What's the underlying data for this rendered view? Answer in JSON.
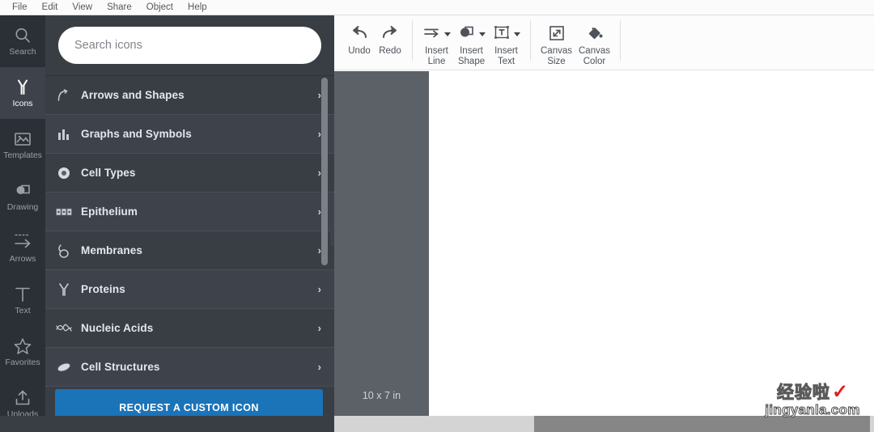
{
  "menubar": {
    "items": [
      {
        "label": "File",
        "name": "menu-file"
      },
      {
        "label": "Edit",
        "name": "menu-edit"
      },
      {
        "label": "View",
        "name": "menu-view"
      },
      {
        "label": "Share",
        "name": "menu-share"
      },
      {
        "label": "Object",
        "name": "menu-object"
      },
      {
        "label": "Help",
        "name": "menu-help"
      }
    ]
  },
  "rail": {
    "items": [
      {
        "label": "Search",
        "icon": "search-icon",
        "active": false
      },
      {
        "label": "Icons",
        "icon": "antibody-icon",
        "active": true
      },
      {
        "label": "Templates",
        "icon": "image-frame-icon",
        "active": false
      },
      {
        "label": "Drawing",
        "icon": "shapes-icon",
        "active": false
      },
      {
        "label": "Arrows",
        "icon": "arrow-right-icon",
        "active": false
      },
      {
        "label": "Text",
        "icon": "text-t-icon",
        "active": false
      },
      {
        "label": "Favorites",
        "icon": "star-icon",
        "active": false
      },
      {
        "label": "Uploads",
        "icon": "upload-icon",
        "active": false
      }
    ]
  },
  "panel": {
    "search": {
      "placeholder": "Search icons",
      "value": ""
    },
    "categories": [
      {
        "label": "Arrows and Shapes",
        "icon": "curved-arrow-icon"
      },
      {
        "label": "Graphs and Symbols",
        "icon": "bar-chart-icon"
      },
      {
        "label": "Cell Types",
        "icon": "cell-circle-icon"
      },
      {
        "label": "Epithelium",
        "icon": "epithelium-icon"
      },
      {
        "label": "Membranes",
        "icon": "membrane-loop-icon"
      },
      {
        "label": "Proteins",
        "icon": "protein-y-icon"
      },
      {
        "label": "Nucleic Acids",
        "icon": "dna-icon"
      },
      {
        "label": "Cell Structures",
        "icon": "organelle-icon"
      }
    ],
    "chevron": "›",
    "custom_button": {
      "label": "REQUEST A CUSTOM ICON",
      "color": "#1b73b8"
    },
    "collapse_handle": {
      "name": "panel-collapse-handle",
      "direction": "left"
    }
  },
  "toolbar": {
    "groups": [
      {
        "buttons": [
          {
            "label": "Undo",
            "icon": "undo-icon",
            "caret": false
          },
          {
            "label": "Redo",
            "icon": "redo-icon",
            "caret": false
          }
        ]
      },
      {
        "buttons": [
          {
            "label": "Insert\nLine",
            "icon": "insert-line-icon",
            "caret": true
          },
          {
            "label": "Insert\nShape",
            "icon": "insert-shape-icon",
            "caret": true
          },
          {
            "label": "Insert\nText",
            "icon": "insert-text-icon",
            "caret": true
          }
        ]
      },
      {
        "buttons": [
          {
            "label": "Canvas\nSize",
            "icon": "canvas-size-icon",
            "caret": false
          },
          {
            "label": "Canvas\nColor",
            "icon": "canvas-color-icon",
            "caret": false
          }
        ]
      }
    ]
  },
  "workspace": {
    "canvas_size_label": "10 x 7 in"
  },
  "watermark": {
    "cn_text": "经验啦",
    "check": "✓",
    "url": "jingyanla.com"
  }
}
